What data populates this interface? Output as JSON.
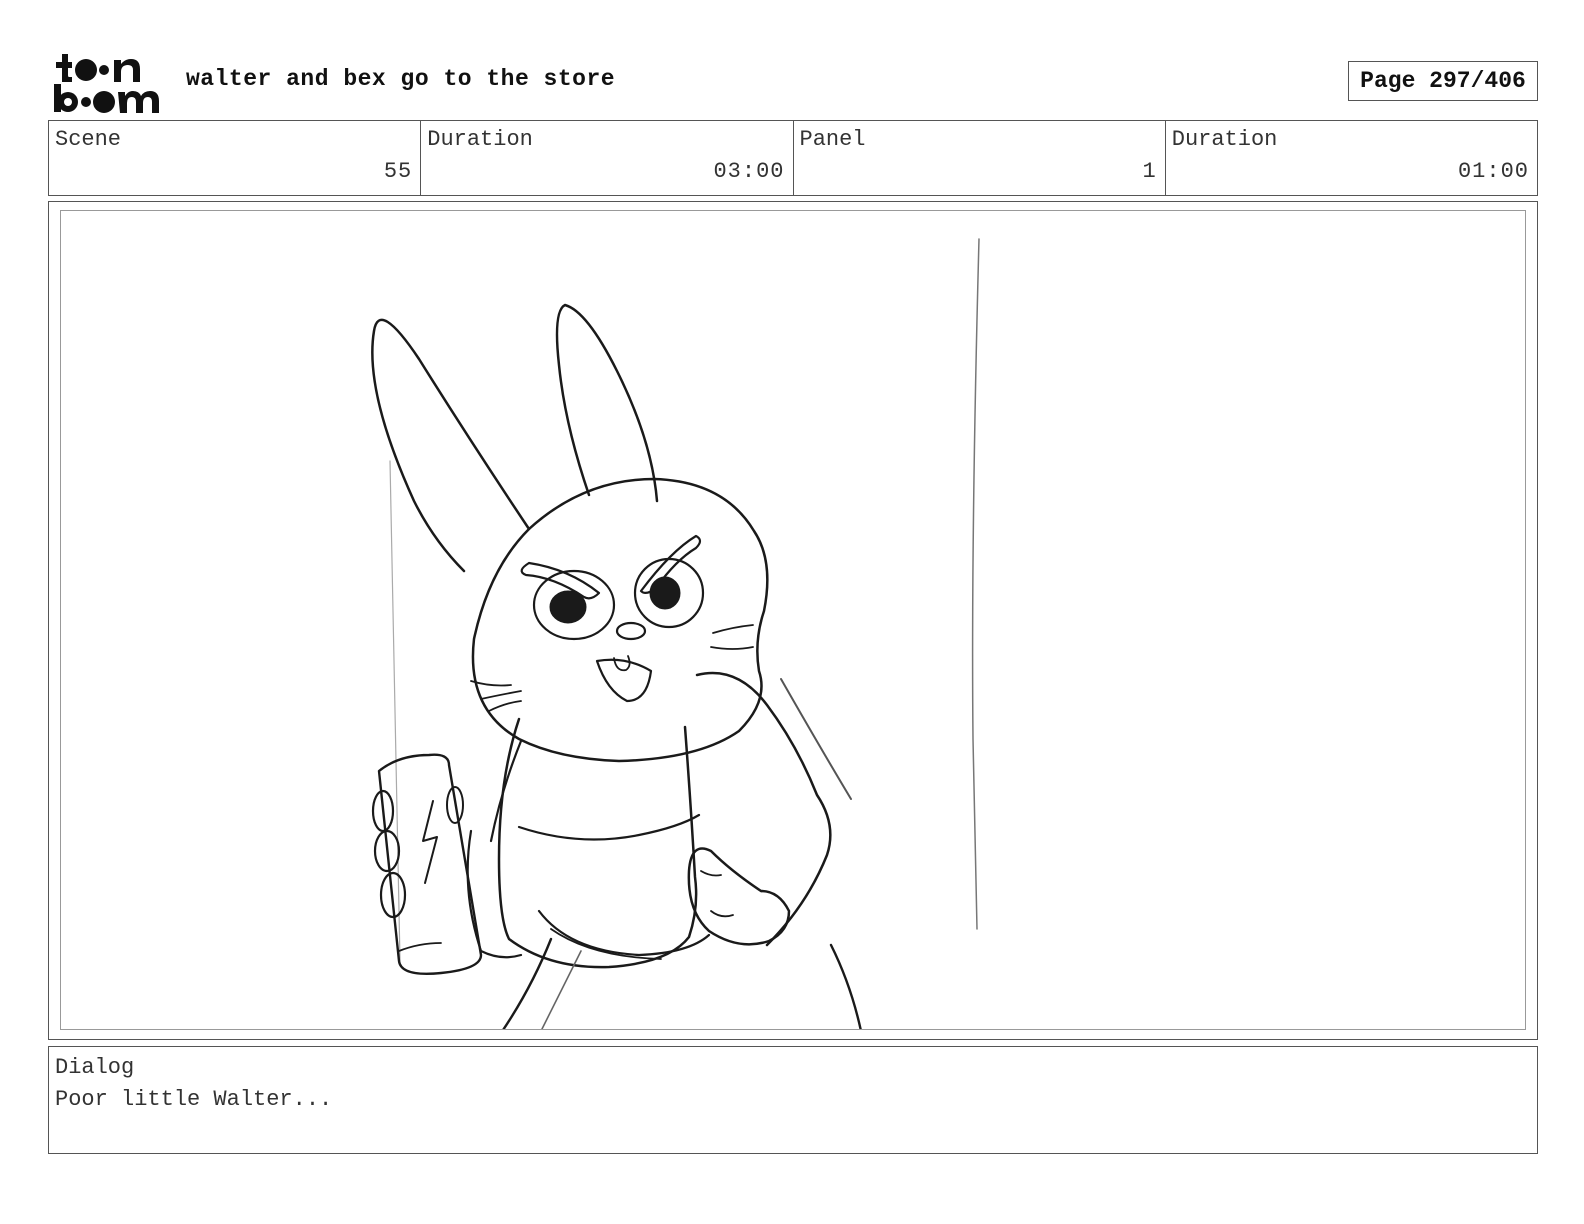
{
  "header": {
    "logo_top": "toon",
    "logo_bottom": "boom",
    "project_title": "walter and bex go to the store",
    "page_label": "Page 297/406"
  },
  "info": {
    "scene_label": "Scene",
    "scene_value": "55",
    "scene_duration_label": "Duration",
    "scene_duration_value": "03:00",
    "panel_label": "Panel",
    "panel_value": "1",
    "panel_duration_label": "Duration",
    "panel_duration_value": "01:00"
  },
  "dialog": {
    "label": "Dialog",
    "text": "Poor little Walter..."
  },
  "sketch": {
    "subject": "angry rabbit character holding a soda can",
    "stroke_color": "#1a1a1a"
  }
}
